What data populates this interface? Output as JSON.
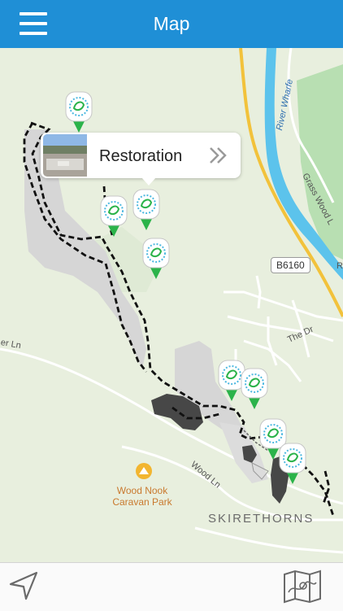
{
  "header": {
    "title": "Map",
    "menu_icon": "hamburger-menu-icon",
    "background": "#1f8fd6"
  },
  "map": {
    "callout": {
      "title": "Restoration",
      "chevron_icon": "double-chevron-right-icon",
      "thumbnail_icon": "quarry-photo-thumbnail"
    },
    "labels": {
      "river": "River Wharfe",
      "road_grass_wood": "Grass Wood L",
      "road_badge": "B6160",
      "road_the_dr": "The Dr",
      "road_left_ln": "er Ln",
      "road_wood_ln": "Wood Ln",
      "poi_line1": "Wood Nook",
      "poi_line2": "Caravan Park",
      "village": "SKIRETHORNS",
      "edge_letter": "R"
    },
    "pin_icon": "quarry-marker-pin-icon",
    "pin_color": "#2bb34a",
    "trail_style": "dashed-black"
  },
  "toolbar": {
    "locate_icon": "location-arrow-icon",
    "maps_icon": "folded-map-icon"
  }
}
